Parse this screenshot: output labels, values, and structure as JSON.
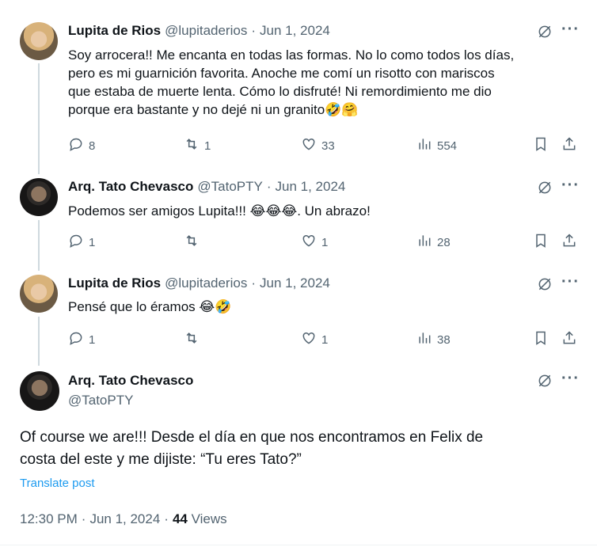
{
  "tweets": [
    {
      "name": "Lupita de Rios",
      "handle": "@lupitaderios",
      "date": "Jun 1, 2024",
      "text1": "Soy arrocera!! Me encanta en todas las formas. No lo como todos los días,",
      "text2": "pero es mi guarnición favorita. Anoche me comí un risotto con mariscos",
      "text3": "que estaba de muerte lenta. Cómo lo disfruté! Ni remordimiento me dio",
      "text4": "porque era bastante y no dejé ni un granito🤣🤗",
      "replies": "8",
      "reposts": "1",
      "likes": "33",
      "views": "554"
    },
    {
      "name": "Arq. Tato Chevasco",
      "handle": "@TatoPTY",
      "date": "Jun 1, 2024",
      "text1": "Podemos ser amigos Lupita!!! 😂😂😂. Un abrazo!",
      "replies": "1",
      "reposts": "",
      "likes": "1",
      "views": "28"
    },
    {
      "name": "Lupita de Rios",
      "handle": "@lupitaderios",
      "date": "Jun 1, 2024",
      "text1": "Pensé que lo éramos 😂🤣",
      "replies": "1",
      "reposts": "",
      "likes": "1",
      "views": "38"
    }
  ],
  "main_tweet": {
    "name": "Arq. Tato Chevasco",
    "handle": "@TatoPTY",
    "text1": "Of course we are!!! Desde el día en que nos encontramos en Felix de",
    "text2": "costa del este y me dijiste: “Tu eres Tato?”",
    "translate": "Translate post",
    "time": "12:30 PM",
    "date": "Jun 1, 2024",
    "dot": "·",
    "views_count": "44",
    "views_label": "Views"
  },
  "separator": "·",
  "more_glyph": "···",
  "icons": [
    "grok-icon",
    "more-icon",
    "reply-icon",
    "repost-icon",
    "like-icon",
    "views-icon",
    "bookmark-icon",
    "share-icon"
  ]
}
